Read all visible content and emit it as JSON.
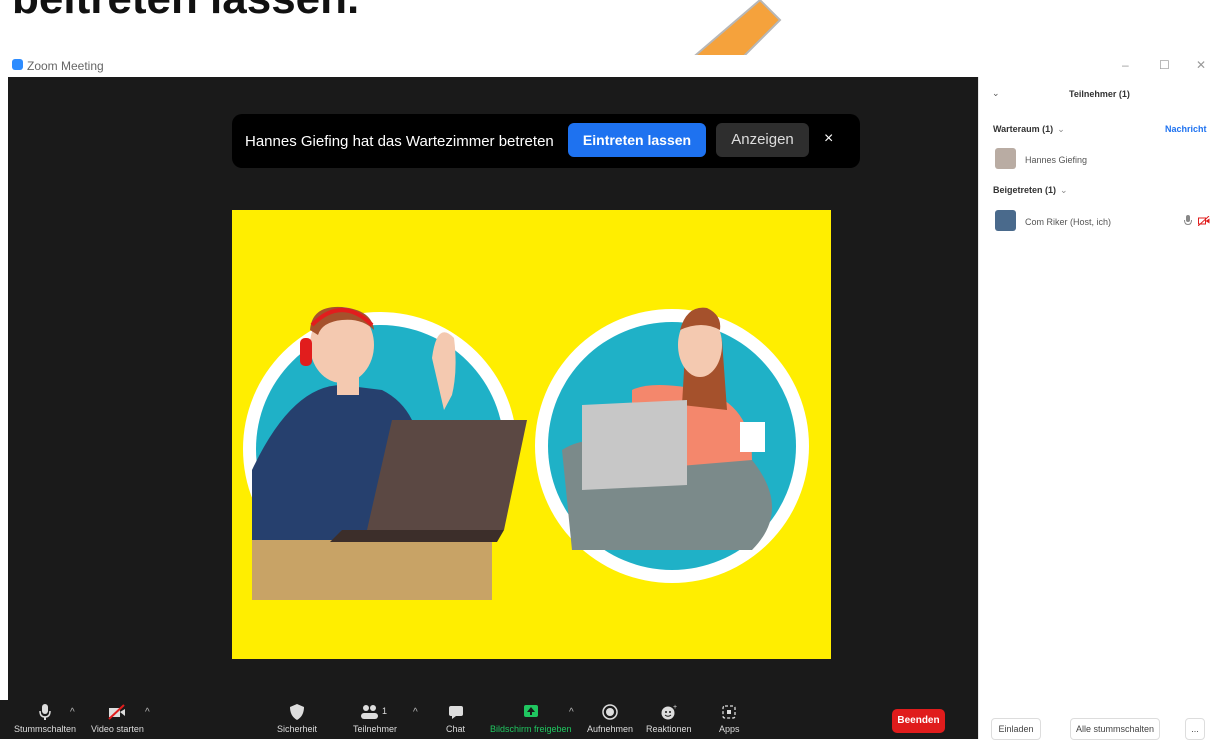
{
  "caption": "beitreten lassen.",
  "window": {
    "title": "Zoom Meeting"
  },
  "notification": {
    "message": "Hannes Giefing hat das Wartezimmer betreten",
    "admit_label": "Eintreten lassen",
    "view_label": "Anzeigen",
    "close_label": "×"
  },
  "toolbar": {
    "mute": "Stummschalten",
    "video": "Video starten",
    "security": "Sicherheit",
    "participants": "Teilnehmer",
    "participants_count": "1",
    "chat": "Chat",
    "share": "Bildschirm freigeben",
    "record": "Aufnehmen",
    "reactions": "Reaktionen",
    "apps": "Apps",
    "end": "Beenden"
  },
  "panel": {
    "title": "Teilnehmer (1)",
    "waiting_room": {
      "label": "Warteraum (1)",
      "message_link": "Nachricht",
      "participants": [
        "Hannes Giefing"
      ]
    },
    "joined": {
      "label": "Beigetreten (1)",
      "participants": [
        "Com Riker (Host, ich)"
      ]
    },
    "invite": "Einladen",
    "mute_all": "Alle stummschalten",
    "more": "..."
  },
  "colors": {
    "accent": "#1e72f0",
    "end": "#e01c1c",
    "share_green": "#20c660",
    "artwork_bg": "#ffee00",
    "arrow": "#f5a23c"
  }
}
